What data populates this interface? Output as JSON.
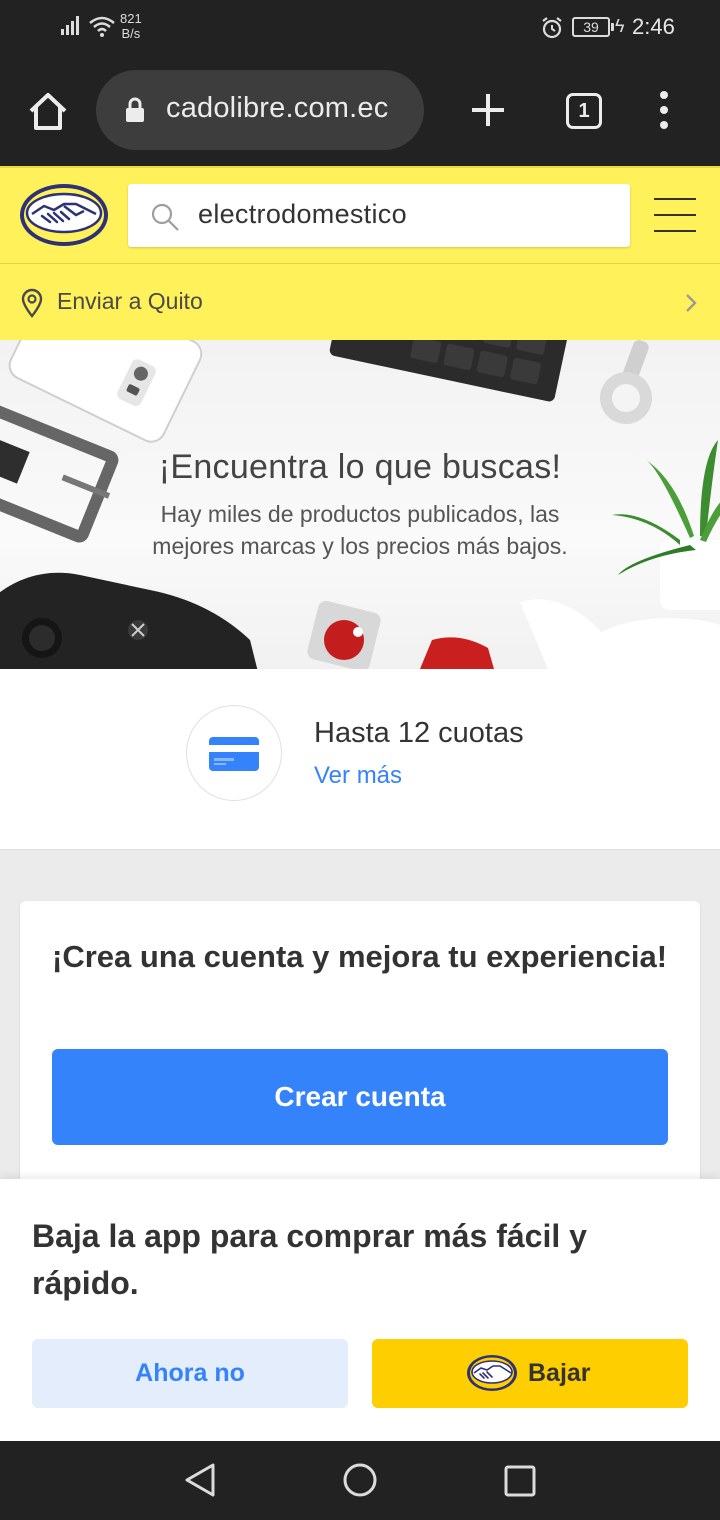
{
  "status_bar": {
    "net_speed_value": "821",
    "net_speed_unit": "B/s",
    "battery": "39",
    "time": "2:46"
  },
  "browser": {
    "url": "cadolibre.com.ec",
    "tab_count": "1"
  },
  "header": {
    "search_value": "electrodomestico"
  },
  "location": {
    "label": "Enviar a Quito"
  },
  "banner": {
    "title": "¡Encuentra lo que buscas!",
    "subtitle_line1": "Hay miles de productos publicados, las",
    "subtitle_line2": "mejores marcas y los precios más bajos."
  },
  "installments": {
    "title": "Hasta 12 cuotas",
    "link": "Ver más"
  },
  "account": {
    "title": "¡Crea una cuenta y mejora tu experiencia!",
    "button": "Crear cuenta"
  },
  "app_banner": {
    "title": "Baja la app para comprar más fácil y rápido.",
    "later_button": "Ahora no",
    "download_button": "Bajar"
  },
  "colors": {
    "brand_yellow": "#fff159",
    "brand_blue": "#3483fa",
    "download_yellow": "#ffce00",
    "system_bar": "#222222"
  },
  "icons": [
    "signal-icon",
    "wifi-icon",
    "alarm-icon",
    "battery-icon",
    "home-icon",
    "lock-icon",
    "plus-icon",
    "tabs-icon",
    "more-vert-icon",
    "mercadolibre-logo-icon",
    "search-icon",
    "hamburger-menu-icon",
    "location-pin-icon",
    "chevron-right-icon",
    "credit-card-icon",
    "nav-back-icon",
    "nav-home-icon",
    "nav-recent-icon"
  ]
}
